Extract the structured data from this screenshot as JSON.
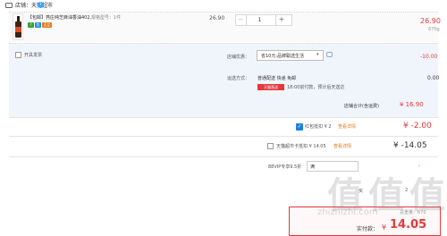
{
  "store": {
    "label": "店铺：天猫超市",
    "badge": "i"
  },
  "product": {
    "title": "【包邮】燕庄纯芝麻油香油402...",
    "spec": "规格型号：1件",
    "tags": [
      "7",
      "包",
      "正品"
    ],
    "unit_price": "26.90",
    "quantity": {
      "minus": "−",
      "value": "1",
      "plus": "+"
    },
    "line_total": "26.90",
    "weight": "670g"
  },
  "options": {
    "invoice_label": "开具发票",
    "coupon": {
      "label": "店铺优惠：",
      "selected": "省10元:品牌聪选生活",
      "amount": "-10.00"
    },
    "shipping": {
      "label": "运送方式：",
      "method": "普通配送 快递 免邮",
      "tag": "天猫直送",
      "note": "18:00前付款，预计后天送达",
      "fee": "0.00"
    },
    "store_total": {
      "label": "店铺合计(含运费)",
      "value": "¥ 16.90"
    }
  },
  "discounts": {
    "redpacket": {
      "check": "✓",
      "label": "红包抵扣 ¥ 2",
      "link": "查看详情",
      "amount": "¥ -2.00"
    },
    "card": {
      "label": "天猫超市卡抵扣 ¥ 14.05",
      "link": "查看详情",
      "amount": "¥ -14.05"
    },
    "vip": {
      "label": "88VIP专享9.5折",
      "box_text": "满",
      "dash": "-"
    },
    "points": {
      "left": "买",
      "right": "2"
    }
  },
  "payment": {
    "weight": "总重量：670",
    "label": "实付款：",
    "currency": "¥",
    "amount": "14.05"
  },
  "watermark": {
    "glyphs": [
      "值",
      "值",
      "值"
    ],
    "site": "zhizhizhi.com"
  },
  "colors": {
    "accent": "#e4393c",
    "options_bg": "#f0f4fb",
    "link_orange": "#e07a16",
    "check_blue": "#1d7fe0"
  },
  "icons": {
    "store": "store-icon",
    "info": "info-badge-icon",
    "chat": "chat-bubble-icon",
    "dropdown": "chevron-down-icon",
    "checkbox": "checkbox-icon"
  }
}
